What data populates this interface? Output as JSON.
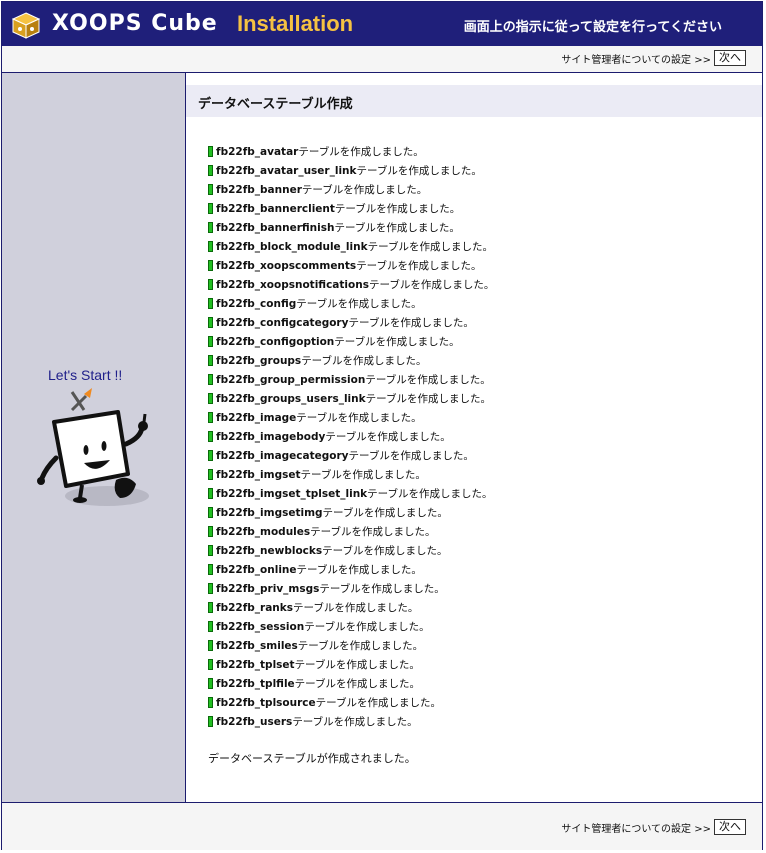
{
  "header": {
    "logo_text": "XOOPS Cube",
    "title": "Installation",
    "instruction": "画面上の指示に従って設定を行ってください"
  },
  "nav": {
    "link_text": "サイト管理者についての設定 >>",
    "next_label": "次へ"
  },
  "sidebar": {
    "lets_start": "Let's Start !!"
  },
  "main": {
    "title": "データベーステーブル作成",
    "suffix": "テーブルを作成しました。",
    "tables": [
      "fb22fb_avatar",
      "fb22fb_avatar_user_link",
      "fb22fb_banner",
      "fb22fb_bannerclient",
      "fb22fb_bannerfinish",
      "fb22fb_block_module_link",
      "fb22fb_xoopscomments",
      "fb22fb_xoopsnotifications",
      "fb22fb_config",
      "fb22fb_configcategory",
      "fb22fb_configoption",
      "fb22fb_groups",
      "fb22fb_group_permission",
      "fb22fb_groups_users_link",
      "fb22fb_image",
      "fb22fb_imagebody",
      "fb22fb_imagecategory",
      "fb22fb_imgset",
      "fb22fb_imgset_tplset_link",
      "fb22fb_imgsetimg",
      "fb22fb_modules",
      "fb22fb_newblocks",
      "fb22fb_online",
      "fb22fb_priv_msgs",
      "fb22fb_ranks",
      "fb22fb_session",
      "fb22fb_smiles",
      "fb22fb_tplset",
      "fb22fb_tplfile",
      "fb22fb_tplsource",
      "fb22fb_users"
    ],
    "completion": "データベーステーブルが作成されました。"
  },
  "colors": {
    "header_bg": "#1f1f7a",
    "accent_gold": "#f5c242",
    "sidebar_bg": "#d0d0dc",
    "success_mark": "#22c022"
  }
}
